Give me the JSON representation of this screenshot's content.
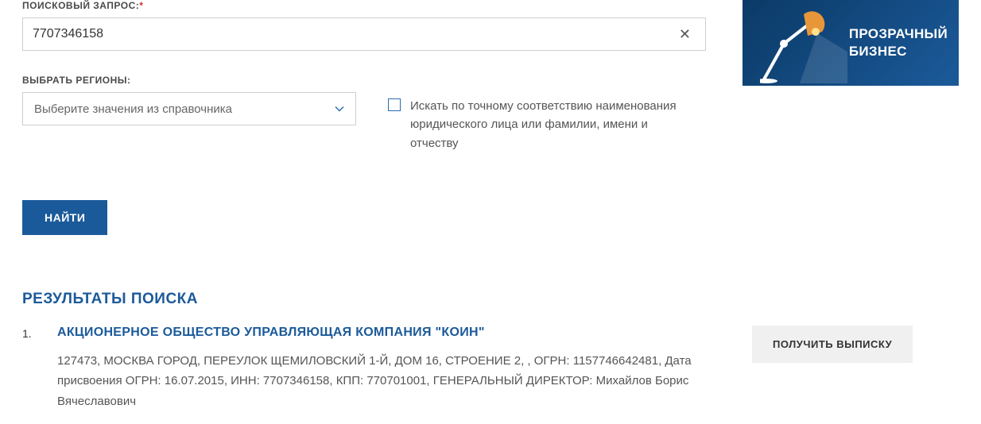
{
  "search": {
    "label": "ПОИСКОВЫЙ ЗАПРОС:",
    "value": "7707346158"
  },
  "region": {
    "label": "ВЫБРАТЬ РЕГИОНЫ:",
    "placeholder": "Выберите значения из справочника"
  },
  "checkbox": {
    "label": "Искать по точному соответствию наименования юридического лица или фамилии, имени и отчеству"
  },
  "banner": {
    "line1": "ПРОЗРАЧНЫЙ",
    "line2": "БИЗНЕС"
  },
  "buttons": {
    "find": "НАЙТИ",
    "extract": "ПОЛУЧИТЬ ВЫПИСКУ"
  },
  "results": {
    "title": "РЕЗУЛЬТАТЫ ПОИСКА",
    "items": [
      {
        "num": "1.",
        "name": "АКЦИОНЕРНОЕ ОБЩЕСТВО УПРАВЛЯЮЩАЯ КОМПАНИЯ \"КОИН\"",
        "details": "127473, МОСКВА ГОРОД, ПЕРЕУЛОК ЩЕМИЛОВСКИЙ 1-Й, ДОМ 16, СТРОЕНИЕ 2, , ОГРН: 1157746642481, Дата присвоения ОГРН: 16.07.2015, ИНН: 7707346158, КПП: 770701001, ГЕНЕРАЛЬНЫЙ ДИРЕКТОР: Михайлов Борис Вячеславович"
      }
    ]
  }
}
